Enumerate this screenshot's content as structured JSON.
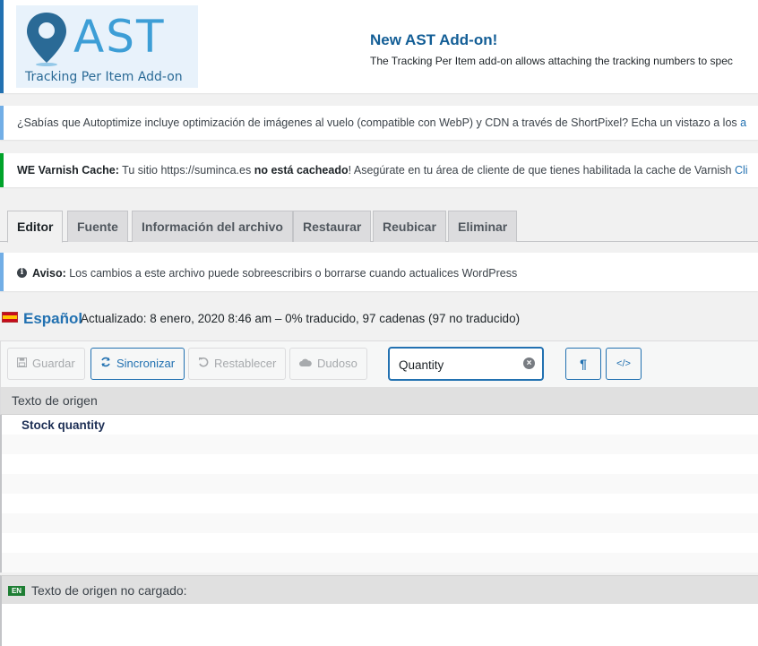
{
  "ast_notice": {
    "logo_word": "AST",
    "logo_tagline": "Tracking Per Item Add-on",
    "title": "New AST Add-on!",
    "description": "The Tracking Per Item add-on allows attaching the tracking numbers to spec"
  },
  "autoptimize_notice": {
    "text": "¿Sabías que Autoptimize incluye optimización de imágenes al vuelo (compatible con WebP) y CDN a través de ShortPixel? Echa un vistazo a los ",
    "link": "a"
  },
  "varnish_notice": {
    "label": "WE Varnish Cache:",
    "text_before": " Tu sitio https://suminca.es ",
    "bold": "no está cacheado",
    "text_after": "! Asegúrate en tu área de cliente de que tienes habilitada la cache de Varnish ",
    "link": "Cli"
  },
  "tabs": [
    {
      "label": "Editor",
      "active": true
    },
    {
      "label": "Fuente"
    },
    {
      "label": "Información del archivo"
    },
    {
      "label": "Restaurar"
    },
    {
      "label": "Reubicar"
    },
    {
      "label": "Eliminar"
    }
  ],
  "aviso": {
    "label": "Aviso:",
    "text": " Los cambios a este archivo puede sobreescribirs o borrarse cuando actualices WordPress"
  },
  "language": {
    "name": "Español",
    "meta": "Actualizado: 8 enero, 2020 8:46 am – 0% traducido, 97 cadenas (97 no traducido)"
  },
  "toolbar": {
    "save": "Guardar",
    "sync": "Sincronizar",
    "revert": "Restablecer",
    "fuzzy": "Dudoso",
    "search_value": "Quantity",
    "pilcrow": "¶",
    "code": "</>"
  },
  "source": {
    "header": "Texto de origen",
    "rows": [
      "Stock quantity",
      "",
      "",
      "",
      "",
      "",
      "",
      ""
    ]
  },
  "bottom": {
    "badge": "EN",
    "header": "Texto de origen no cargado:"
  }
}
